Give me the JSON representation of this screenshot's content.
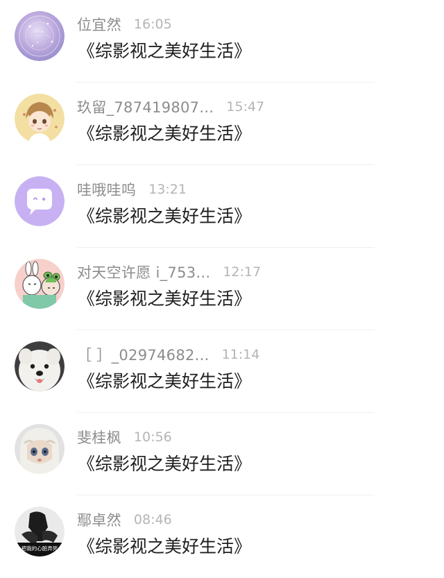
{
  "conversations": [
    {
      "name": "位宜然",
      "time": "16:05",
      "message": "《综影视之美好生活》",
      "avatar_icon": "galaxy-pattern-avatar-icon",
      "avatar_color": "#b8a6d8"
    },
    {
      "name": "玖留_787419807...",
      "time": "15:47",
      "message": "《综影视之美好生活》",
      "avatar_icon": "anime-boy-avatar-icon",
      "avatar_color": "#f2dd9e"
    },
    {
      "name": "哇哦哇呜",
      "time": "13:21",
      "message": "《综影视之美好生活》",
      "avatar_icon": "chat-bubble-avatar-icon",
      "avatar_color": "#c6aff2"
    },
    {
      "name": "对天空许愿 i_753...",
      "time": "12:17",
      "message": "《综影视之美好生活》",
      "avatar_icon": "bunny-frog-couple-avatar-icon",
      "avatar_color": "#f6c7c7"
    },
    {
      "name": "［ ］_02974682...",
      "time": "11:14",
      "message": "《综影视之美好生活》",
      "avatar_icon": "white-dog-avatar-icon",
      "avatar_color": "#4a4a4a"
    },
    {
      "name": "斐桂枫",
      "time": "10:56",
      "message": "《综影视之美好生活》",
      "avatar_icon": "doll-face-avatar-icon",
      "avatar_color": "#d8d8d8"
    },
    {
      "name": "鄢卓然",
      "time": "08:46",
      "message": "《综影视之美好生活》",
      "avatar_icon": "dark-figure-avatar-icon",
      "avatar_color": "#2a2a2a",
      "avatar_caption": "把我的心脏弄死"
    }
  ]
}
